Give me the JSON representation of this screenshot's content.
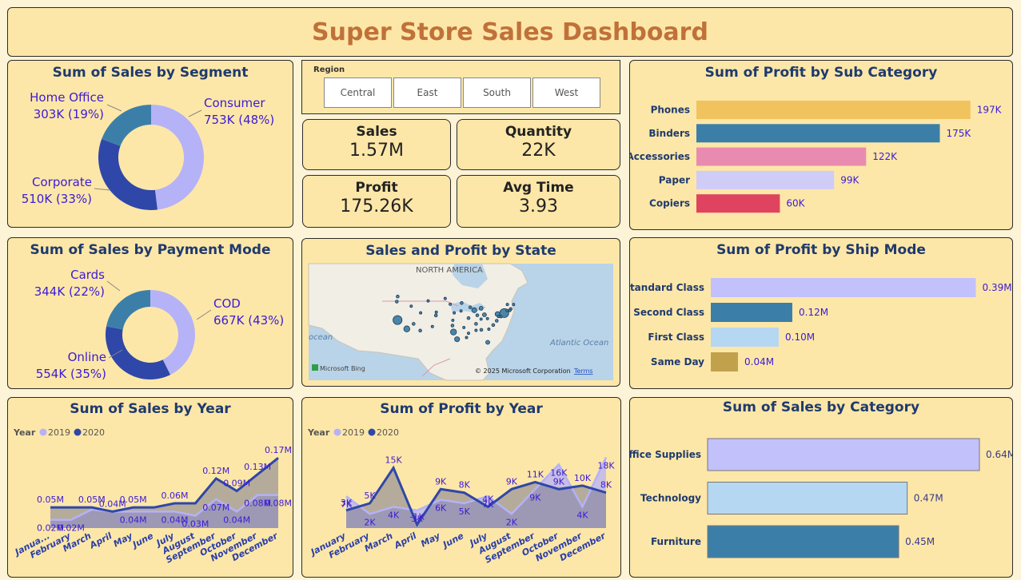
{
  "title": "Super Store Sales Dashboard",
  "segment": {
    "title": "Sum of Sales by Segment",
    "labels": [
      {
        "name": "Home Office",
        "value": "303K (19%)"
      },
      {
        "name": "Consumer",
        "value": "753K (48%)"
      },
      {
        "name": "Corporate",
        "value": "510K (33%)"
      }
    ]
  },
  "region": {
    "label": "Region",
    "options": [
      "Central",
      "East",
      "South",
      "West"
    ]
  },
  "kpis": {
    "sales": {
      "label": "Sales",
      "value": "1.57M"
    },
    "quantity": {
      "label": "Quantity",
      "value": "22K"
    },
    "profit": {
      "label": "Profit",
      "value": "175.26K"
    },
    "avgtime": {
      "label": "Avg Time",
      "value": "3.93"
    }
  },
  "subcat": {
    "title": "Sum of Profit by Sub Category"
  },
  "payment": {
    "title": "Sum of Sales by Payment Mode",
    "labels": [
      {
        "name": "Cards",
        "value": "344K (22%)"
      },
      {
        "name": "COD",
        "value": "667K (43%)"
      },
      {
        "name": "Online",
        "value": "554K (35%)"
      }
    ]
  },
  "map": {
    "title": "Sales and Profit by State",
    "continent": "NORTH AMERICA",
    "ocean_left": "ocean",
    "ocean_right": "Atlantic Ocean",
    "bing": "Microsoft Bing",
    "copyright": "© 2025 Microsoft Corporation",
    "terms": "Terms"
  },
  "shipmode": {
    "title": "Sum of Profit by Ship Mode"
  },
  "salesyear": {
    "title": "Sum of Sales by Year",
    "legend_title": "Year"
  },
  "profityear": {
    "title": "Sum of Profit by Year",
    "legend_title": "Year"
  },
  "category": {
    "title": "Sum of Sales by Category"
  },
  "colors": {
    "accent_title": "#c0713a",
    "navy": "#1f3a6e",
    "label_purple": "#3b1bd6",
    "series_2019": "#b5b2f8",
    "series_2020": "#2f47a8"
  },
  "chart_data": [
    {
      "type": "pie",
      "title": "Sum of Sales by Segment",
      "categories": [
        "Consumer",
        "Corporate",
        "Home Office"
      ],
      "values": [
        753,
        510,
        303
      ],
      "unit": "K",
      "colors": [
        "#b5b2f8",
        "#2f47a8",
        "#3b7fa8"
      ]
    },
    {
      "type": "bar",
      "orientation": "horizontal",
      "title": "Sum of Profit by Sub Category",
      "categories": [
        "Phones",
        "Binders",
        "Accessories",
        "Paper",
        "Copiers"
      ],
      "values": [
        197,
        175,
        122,
        99,
        60
      ],
      "labels": [
        "197K",
        "175K",
        "122K",
        "99K",
        "60K"
      ],
      "colors": [
        "#f0c35e",
        "#3b7fa8",
        "#e98bb0",
        "#cfccf8",
        "#e0435f"
      ],
      "xlim": [
        0,
        200
      ]
    },
    {
      "type": "pie",
      "title": "Sum of Sales by Payment Mode",
      "categories": [
        "COD",
        "Online",
        "Cards"
      ],
      "values": [
        667,
        554,
        344
      ],
      "unit": "K",
      "colors": [
        "#b5b2f8",
        "#2f47a8",
        "#3b7fa8"
      ]
    },
    {
      "type": "scatter",
      "title": "Sales and Profit by State",
      "points": [
        {
          "lon": -122.4,
          "lat": 37.8,
          "size": 9
        },
        {
          "lon": -118.2,
          "lat": 34.1,
          "size": 6
        },
        {
          "lon": -122.3,
          "lat": 47.6,
          "size": 3
        },
        {
          "lon": -122.7,
          "lat": 45.5,
          "size": 3
        },
        {
          "lon": -116.2,
          "lat": 43.6,
          "size": 2.5
        },
        {
          "lon": -111.9,
          "lat": 40.8,
          "size": 2.5
        },
        {
          "lon": -115.1,
          "lat": 36.2,
          "size": 3
        },
        {
          "lon": -112.1,
          "lat": 33.4,
          "size": 3
        },
        {
          "lon": -105.0,
          "lat": 39.7,
          "size": 3
        },
        {
          "lon": -106.6,
          "lat": 35.1,
          "size": 2.5
        },
        {
          "lon": -108.5,
          "lat": 45.8,
          "size": 2.5
        },
        {
          "lon": -104.8,
          "lat": 41.1,
          "size": 2.5
        },
        {
          "lon": -100.8,
          "lat": 46.8,
          "size": 2.5
        },
        {
          "lon": -98.5,
          "lat": 44.4,
          "size": 2.5
        },
        {
          "lon": -96.7,
          "lat": 40.8,
          "size": 2.5
        },
        {
          "lon": -97.3,
          "lat": 37.7,
          "size": 2.5
        },
        {
          "lon": -97.5,
          "lat": 35.5,
          "size": 3
        },
        {
          "lon": -97.0,
          "lat": 32.8,
          "size": 6
        },
        {
          "lon": -95.4,
          "lat": 29.8,
          "size": 5
        },
        {
          "lon": -93.3,
          "lat": 44.9,
          "size": 3
        },
        {
          "lon": -93.6,
          "lat": 41.6,
          "size": 2.5
        },
        {
          "lon": -90.2,
          "lat": 38.6,
          "size": 3
        },
        {
          "lon": -92.3,
          "lat": 34.7,
          "size": 2.5
        },
        {
          "lon": -91.1,
          "lat": 30.5,
          "size": 2.5
        },
        {
          "lon": -89.4,
          "lat": 43.1,
          "size": 3
        },
        {
          "lon": -87.6,
          "lat": 41.9,
          "size": 5
        },
        {
          "lon": -86.2,
          "lat": 39.8,
          "size": 3
        },
        {
          "lon": -84.5,
          "lat": 42.7,
          "size": 4
        },
        {
          "lon": -83.0,
          "lat": 40.0,
          "size": 4
        },
        {
          "lon": -84.5,
          "lat": 38.2,
          "size": 2.5
        },
        {
          "lon": -86.8,
          "lat": 36.2,
          "size": 3
        },
        {
          "lon": -90.2,
          "lat": 32.3,
          "size": 2.5
        },
        {
          "lon": -86.8,
          "lat": 33.5,
          "size": 2.5
        },
        {
          "lon": -84.4,
          "lat": 33.7,
          "size": 3
        },
        {
          "lon": -81.5,
          "lat": 28.5,
          "size": 4
        },
        {
          "lon": -81.0,
          "lat": 34.0,
          "size": 2.5
        },
        {
          "lon": -79.0,
          "lat": 35.7,
          "size": 3
        },
        {
          "lon": -77.4,
          "lat": 37.5,
          "size": 3
        },
        {
          "lon": -81.6,
          "lat": 38.4,
          "size": 2.5
        },
        {
          "lon": -77.0,
          "lat": 40.3,
          "size": 5
        },
        {
          "lon": -74.0,
          "lat": 40.7,
          "size": 9
        },
        {
          "lon": -71.1,
          "lat": 42.4,
          "size": 3
        },
        {
          "lon": -72.7,
          "lat": 41.8,
          "size": 2.5
        },
        {
          "lon": -75.5,
          "lat": 39.2,
          "size": 2.5
        },
        {
          "lon": -76.6,
          "lat": 39.3,
          "size": 2.5
        },
        {
          "lon": -71.5,
          "lat": 41.8,
          "size": 2.5
        },
        {
          "lon": -72.6,
          "lat": 44.3,
          "size": 2.5
        },
        {
          "lon": -69.8,
          "lat": 44.3,
          "size": 2.5
        }
      ]
    },
    {
      "type": "bar",
      "orientation": "horizontal",
      "title": "Sum of Profit by Ship Mode",
      "categories": [
        "Standard Class",
        "Second Class",
        "First Class",
        "Same Day"
      ],
      "values": [
        0.39,
        0.12,
        0.1,
        0.04
      ],
      "labels": [
        "0.39M",
        "0.12M",
        "0.10M",
        "0.04M"
      ],
      "colors": [
        "#c3c1fb",
        "#3b7fa8",
        "#b6d7f2",
        "#c2a14d"
      ],
      "xlim": [
        0,
        0.4
      ]
    },
    {
      "type": "area",
      "title": "Sum of Sales by Year",
      "x": [
        "January",
        "February",
        "March",
        "April",
        "May",
        "June",
        "July",
        "August",
        "September",
        "October",
        "November",
        "December"
      ],
      "x_tick_labels": [
        "Janua...",
        "February",
        "March",
        "April",
        "May",
        "June",
        "July",
        "August",
        "September",
        "October",
        "November",
        "December"
      ],
      "legend": [
        "2019",
        "2020"
      ],
      "series": [
        {
          "name": "2019",
          "values": [
            0.02,
            0.02,
            0.045,
            0.04,
            0.04,
            0.04,
            0.04,
            0.03,
            0.07,
            0.04,
            0.08,
            0.08
          ],
          "labels": [
            "0.02M",
            "0.02M",
            "",
            "",
            "0.04M",
            "",
            "0.04M",
            "0.03M",
            "0.07M",
            "0.04M",
            "0.08M",
            "0.08M"
          ]
        },
        {
          "name": "2020",
          "values": [
            0.05,
            0.05,
            0.05,
            0.04,
            0.05,
            0.05,
            0.06,
            0.06,
            0.12,
            0.09,
            0.13,
            0.17
          ],
          "labels": [
            "0.05M",
            "",
            "0.05M",
            "0.04M",
            "0.05M",
            "",
            "0.06M",
            "",
            "0.12M",
            "0.09M",
            "0.13M",
            "0.17M"
          ]
        }
      ],
      "ylim": [
        0,
        0.18
      ]
    },
    {
      "type": "area",
      "title": "Sum of Profit by Year",
      "x": [
        "January",
        "February",
        "March",
        "April",
        "May",
        "June",
        "July",
        "August",
        "September",
        "October",
        "November",
        "December"
      ],
      "legend": [
        "2019",
        "2020"
      ],
      "series": [
        {
          "name": "2019",
          "values": [
            7,
            2,
            4,
            3,
            6,
            5,
            7,
            2,
            9,
            16,
            4,
            18
          ],
          "labels": [
            "7K",
            "2K",
            "4K",
            "3K",
            "6K",
            "5K",
            "7K",
            "2K",
            "9K",
            "16K",
            "4K",
            "18K"
          ]
        },
        {
          "name": "2020",
          "values": [
            3,
            5,
            15,
            -1,
            9,
            8,
            4,
            9,
            11,
            9,
            10,
            8
          ],
          "labels": [
            "3K",
            "5K",
            "15K",
            "-1K",
            "9K",
            "8K",
            "4K",
            "9K",
            "11K",
            "9K",
            "10K",
            "8K"
          ]
        }
      ],
      "ylim": [
        -2,
        19
      ]
    },
    {
      "type": "bar",
      "orientation": "horizontal",
      "title": "Sum of Sales by Category",
      "categories": [
        "Office Supplies",
        "Technology",
        "Furniture"
      ],
      "values": [
        0.64,
        0.47,
        0.45
      ],
      "labels": [
        "0.64M",
        "0.47M",
        "0.45M"
      ],
      "colors": [
        "#c3c1fb",
        "#b6d7f2",
        "#3b7fa8"
      ],
      "xlim": [
        0,
        0.64
      ]
    }
  ]
}
